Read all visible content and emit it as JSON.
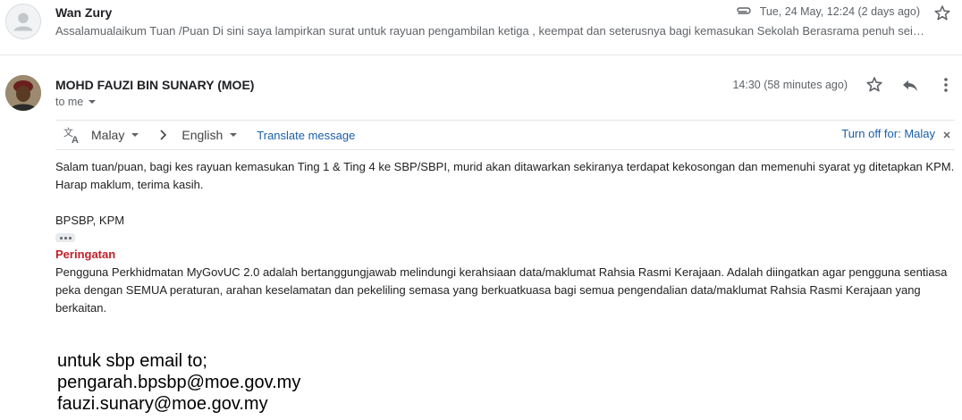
{
  "previous_message": {
    "sender": "Wan Zury",
    "snippet": "Assalamualaikum Tuan /Puan Di sini saya lampirkan surat untuk rayuan pengambilan ketiga , keempat dan seterusnya bagi kemasukan Sekolah Berasrama penuh sei…",
    "date": "Tue, 24 May, 12:24 (2 days ago)",
    "attachment_icon": "paperclip-icon",
    "star_icon": "star-outline-icon"
  },
  "message": {
    "sender": "MOHD FAUZI BIN SUNARY (MOE)",
    "recipient": "to me",
    "time": "14:30 (58 minutes ago)",
    "star_icon": "star-outline-icon",
    "reply_icon": "reply-icon",
    "more_icon": "more-vert-icon"
  },
  "translate_bar": {
    "source_lang": "Malay",
    "target_lang": "English",
    "translate_link": "Translate message",
    "turn_off": "Turn off for: Malay"
  },
  "body": {
    "paragraph1": "Salam tuan/puan, bagi kes rayuan kemasukan Ting 1 & Ting 4 ke SBP/SBPI, murid akan ditawarkan sekiranya terdapat kekosongan dan memenuhi syarat yg ditetapkan KPM. Harap maklum, terima kasih.",
    "signature": "BPSBP, KPM",
    "warning_title": "Peringatan",
    "warning_text": "Pengguna Perkhidmatan MyGovUC 2.0 adalah bertanggungjawab melindungi kerahsiaan data/maklumat Rahsia Rasmi Kerajaan. Adalah diingatkan agar pengguna sentiasa peka dengan SEMUA peraturan, arahan keselamatan dan pekeliling semasa yang berkuatkuasa bagi semua pengendalian data/maklumat Rahsia Rasmi Kerajaan yang berkaitan."
  },
  "footer_note": {
    "line1": "untuk sbp email to;",
    "line2": "pengarah.bpsbp@moe.gov.my",
    "line3": "fauzi.sunary@moe.gov.my"
  },
  "colors": {
    "link": "#1a5fa8",
    "warning": "#c0202a",
    "muted": "#5f6368"
  }
}
